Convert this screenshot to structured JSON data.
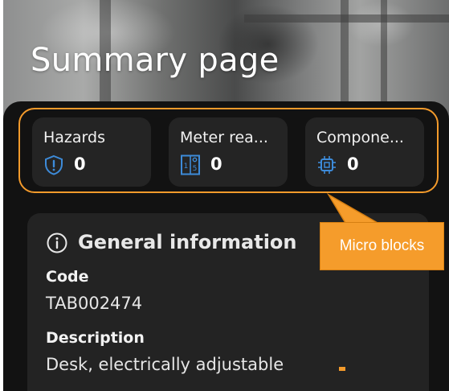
{
  "header": {
    "title": "Summary page"
  },
  "micro_blocks": [
    {
      "label": "Hazards",
      "count": "0",
      "icon": "shield-alert-icon"
    },
    {
      "label": "Meter rea...",
      "count": "0",
      "icon": "meter-icon"
    },
    {
      "label": "Compone...",
      "count": "0",
      "icon": "chip-icon"
    }
  ],
  "general_info": {
    "title": "General information",
    "icon": "info-icon",
    "code_label": "Code",
    "code_value": "TAB002474",
    "description_label": "Description",
    "description_value": "Desk, electrically adjustable"
  },
  "annotation": {
    "text": "Micro blocks",
    "color": "#f39a2b"
  },
  "colors": {
    "panel": "#121212",
    "card": "#242424",
    "accent_icon": "#3d8bd9",
    "annotation": "#f39a2b"
  }
}
